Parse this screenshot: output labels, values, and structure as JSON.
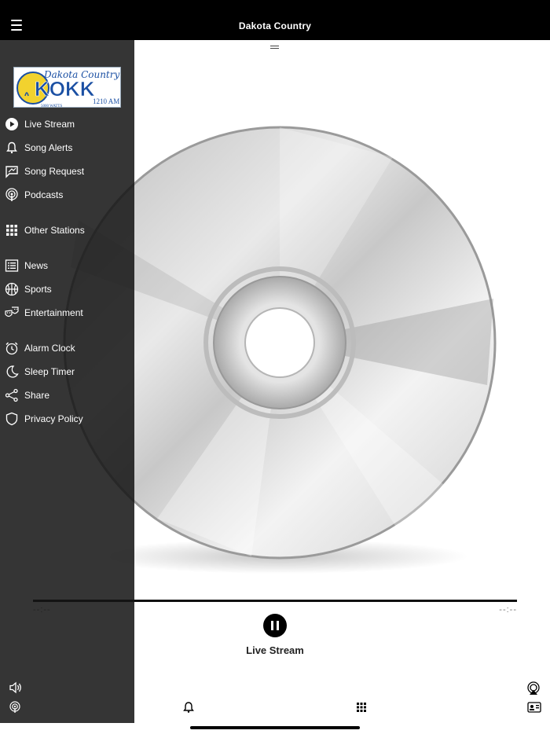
{
  "header": {
    "title": "Dakota Country",
    "menu_icon": "hamburger-menu-icon"
  },
  "sidebar": {
    "logo": {
      "script_text": "Dakota Country",
      "call_letters": "KOKK",
      "frequency": "1210 AM",
      "power": "5000 WATTS",
      "colors": {
        "blue": "#1a4fa3",
        "yellow": "#f2d22e"
      }
    },
    "items": [
      {
        "label": "Live Stream",
        "icon": "play-circle-icon"
      },
      {
        "label": "Song Alerts",
        "icon": "bell-icon"
      },
      {
        "label": "Song Request",
        "icon": "song-request-icon"
      },
      {
        "label": "Podcasts",
        "icon": "podcast-icon"
      },
      {
        "label": "Other Stations",
        "icon": "grid-icon"
      },
      {
        "label": "News",
        "icon": "news-list-icon"
      },
      {
        "label": "Sports",
        "icon": "basketball-icon"
      },
      {
        "label": "Entertainment",
        "icon": "theater-masks-icon"
      },
      {
        "label": "Alarm Clock",
        "icon": "alarm-clock-icon"
      },
      {
        "label": "Sleep Timer",
        "icon": "moon-icon"
      },
      {
        "label": "Share",
        "icon": "share-icon"
      },
      {
        "label": "Privacy Policy",
        "icon": "shield-icon"
      }
    ]
  },
  "player": {
    "elapsed": "--:--",
    "remaining": "--:--",
    "stream_label": "Live Stream",
    "state": "playing"
  },
  "bottom_bar": {
    "icons": [
      "volume-icon",
      "podcast-icon",
      "bell-icon",
      "grid-icon",
      "airplay-icon",
      "contact-card-icon"
    ]
  },
  "colors": {
    "header_bg": "#000000",
    "sidebar_bg": "#2b2b2b",
    "accent": "#000000"
  }
}
